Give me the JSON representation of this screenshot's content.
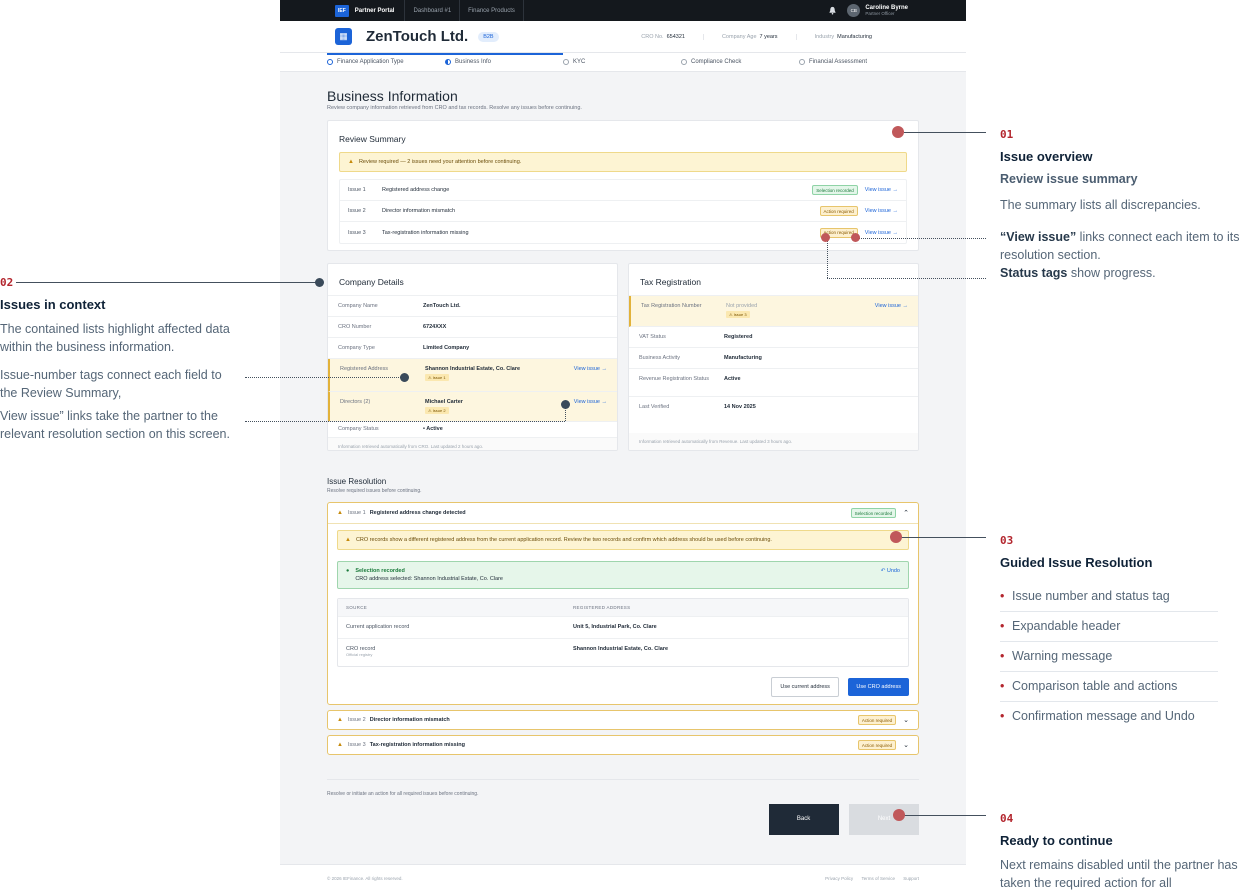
{
  "annotations": {
    "a1": {
      "num": "01",
      "title": "Issue overview",
      "sub": "Review issue summary",
      "text1": "The summary lists all discrepancies.",
      "text2_b1": "“View issue”",
      "text2_rest1": " links connect each item to its resolution section.",
      "text2_b2": "Status tags",
      "text2_rest2": " show progress."
    },
    "a2": {
      "num": "02",
      "title": "Issues in context",
      "text1": "The contained lists highlight affected data within the business information.",
      "text2": "Issue-number tags connect each field to the Review Summary,",
      "text3": "View issue” links take the partner to the relevant resolution section on this screen."
    },
    "a3": {
      "num": "03",
      "title": "Guided Issue Resolution",
      "items": [
        "Issue number and status tag",
        "Expandable header",
        "Warning message",
        "Comparison table and actions",
        "Confirmation message and Undo"
      ]
    },
    "a4": {
      "num": "04",
      "title": "Ready to continue",
      "text": "Next remains disabled until the partner has taken the required action for all"
    }
  },
  "topbar": {
    "logo": "IEF",
    "portal": "Partner Portal",
    "tabs": [
      "Dashboard #1",
      "Finance Products"
    ],
    "user_initials": "CB",
    "user_name": "Caroline Byrne",
    "user_role": "Partner Officer"
  },
  "header": {
    "company": "ZenTouch Ltd.",
    "badge": "B2B",
    "cro_label": "CRO No.",
    "cro_value": "654321",
    "age_label": "Company Age",
    "age_value": "7 years",
    "industry_label": "Industry",
    "industry_value": "Manufacturing"
  },
  "steps": [
    "Finance Application Type",
    "Business Info",
    "KYC",
    "Compliance Check",
    "Financial Assessment"
  ],
  "page": {
    "title": "Business Information",
    "subtitle": "Review company information retrieved from CRO and tax records. Resolve any issues before continuing."
  },
  "review": {
    "title": "Review Summary",
    "banner": "Review required — 2 issues need your attention before continuing.",
    "issues": [
      {
        "num": "Issue 1",
        "text": "Registered address change",
        "tag": "Selection recorded",
        "link": "View issue →"
      },
      {
        "num": "Issue 2",
        "text": "Director information mismatch",
        "tag": "Action required",
        "link": "View issue →"
      },
      {
        "num": "Issue 3",
        "text": "Tax-registration information missing",
        "tag": "Action required",
        "link": "View issue →"
      }
    ]
  },
  "company_details": {
    "title": "Company Details",
    "rows": [
      {
        "k": "Company Name",
        "v": "ZenTouch Ltd."
      },
      {
        "k": "CRO Number",
        "v": "6724XXX"
      },
      {
        "k": "Company Type",
        "v": "Limited Company"
      },
      {
        "k": "Registered Address",
        "v": "Shannon Industrial Estate, Co. Clare",
        "tag": "⚠ Issue 1",
        "link": "View issue →"
      },
      {
        "k": "Directors (2)",
        "v": "Michael Carter",
        "tag": "⚠ Issue 2",
        "link": "View issue →"
      },
      {
        "k": "Company Status",
        "v": "• Active"
      }
    ],
    "note": "Information retrieved automatically from CRO. Last updated 2 hours ago."
  },
  "tax_registration": {
    "title": "Tax Registration",
    "rows": [
      {
        "k": "Tax Registration Number",
        "v": "Not provided",
        "tag": "⚠ Issue 3",
        "link": "View issue →"
      },
      {
        "k": "VAT Status",
        "v": "Registered"
      },
      {
        "k": "Business Activity",
        "v": "Manufacturing"
      },
      {
        "k": "Revenue Registration Status",
        "v": "Active"
      },
      {
        "k": "Last Verified",
        "v": "14 Nov 2025"
      }
    ],
    "note": "Information retrieved automatically from Revenue. Last updated 3 hours ago."
  },
  "resolution": {
    "title": "Issue Resolution",
    "subtitle": "Resolve required issues before continuing.",
    "issue1": {
      "num": "Issue 1",
      "title": "Registered address change detected",
      "tag": "Selection recorded",
      "warning": "CRO records show a different registered address from the current application record. Review the two records and confirm which address should be used before continuing.",
      "success_title": "Selection recorded",
      "success_text": "CRO address selected: Shannon Industrial Estate, Co. Clare",
      "undo": "Undo",
      "col_source": "SOURCE",
      "col_addr": "REGISTERED ADDRESS",
      "rows": [
        {
          "source": "Current application record",
          "sub": "",
          "addr": "Unit 5, Industrial Park, Co. Clare"
        },
        {
          "source": "CRO record",
          "sub": "Official registry",
          "addr": "Shannon Industrial Estate, Co. Clare"
        }
      ],
      "btn_current": "Use current address",
      "btn_cro": "Use CRO address"
    },
    "issue2": {
      "num": "Issue 2",
      "title": "Director information mismatch",
      "tag": "Action required"
    },
    "issue3": {
      "num": "Issue 3",
      "title": "Tax-registration information missing",
      "tag": "Action required"
    }
  },
  "bottom": {
    "note": "Resolve or initiate an action for all required issues before continuing.",
    "back": "Back",
    "next": "Next"
  },
  "footer": {
    "copy": "© 2026 IEFinance. All rights reserved.",
    "links": [
      "Privacy Policy",
      "Terms of Service",
      "Support"
    ]
  }
}
